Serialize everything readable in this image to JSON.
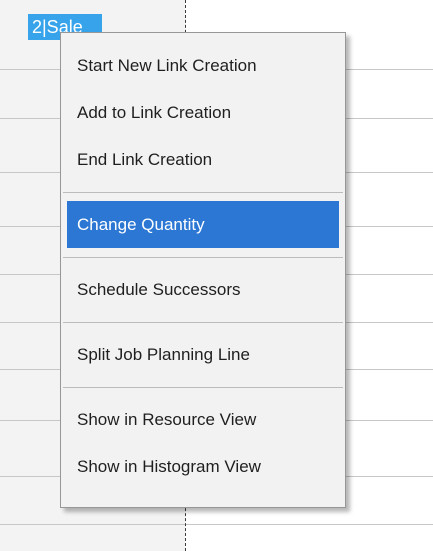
{
  "task_tag": {
    "label": "2|Sale"
  },
  "context_menu": {
    "group_links": [
      {
        "label": "Start New Link Creation"
      },
      {
        "label": "Add to Link Creation"
      },
      {
        "label": "End Link Creation"
      }
    ],
    "change_quantity": {
      "label": "Change Quantity",
      "state": "highlighted"
    },
    "schedule_successors": {
      "label": "Schedule Successors"
    },
    "split_job": {
      "label": "Split Job Planning Line"
    },
    "group_views": [
      {
        "label": "Show in Resource View"
      },
      {
        "label": "Show in Histogram View"
      }
    ]
  },
  "colors": {
    "highlight": "#2b77d3",
    "task_tag": "#36a3ea",
    "menu_background": "#f2f2f2"
  }
}
